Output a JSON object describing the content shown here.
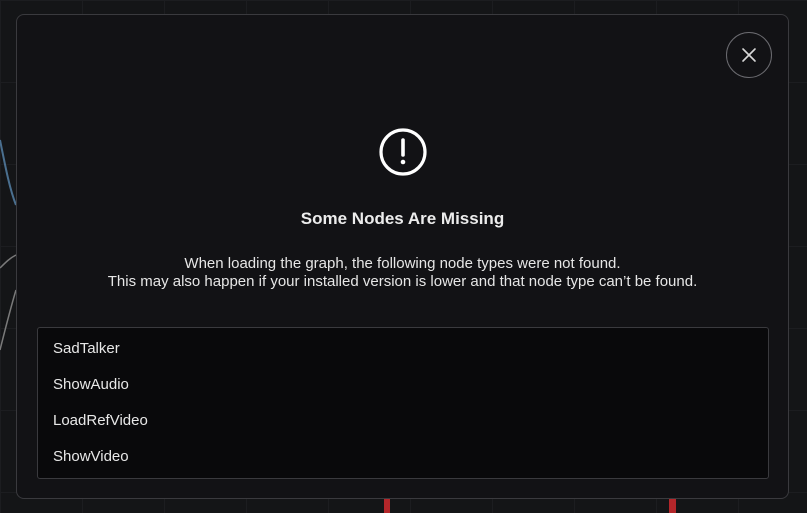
{
  "dialog": {
    "title": "Some Nodes Are Missing",
    "description_line1": "When loading the graph, the following node types were not found.",
    "description_line2": "This may also happen if your installed version is lower and that node type can’t be found.",
    "icons": {
      "warning": "exclamation-circle-icon",
      "close": "close-icon"
    }
  },
  "missing_nodes": [
    {
      "label": "SadTalker"
    },
    {
      "label": "ShowAudio"
    },
    {
      "label": "LoadRefVideo"
    },
    {
      "label": "ShowVideo"
    }
  ],
  "colors": {
    "modal_background": "#121215",
    "list_background": "#09090b",
    "border": "#3a3a3e",
    "text": "#ececec",
    "link_wire": "#4a6f8f",
    "accent_red": "#b3262a"
  }
}
